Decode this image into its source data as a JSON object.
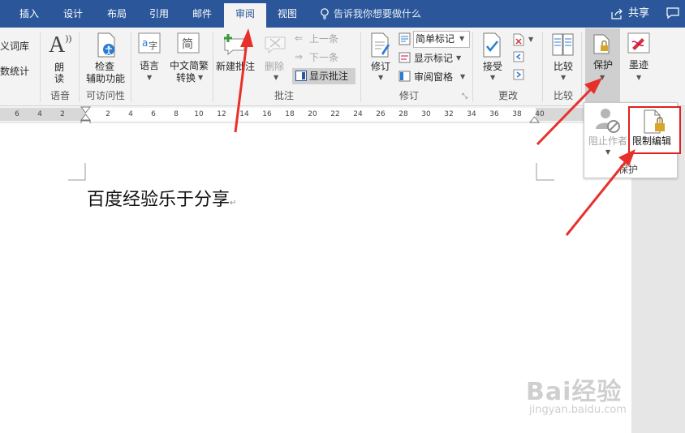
{
  "tabs": [
    "插入",
    "设计",
    "布局",
    "引用",
    "邮件",
    "审阅",
    "视图"
  ],
  "tell_me": "告诉我你想要做什么",
  "share": "共享",
  "ribbon": {
    "proofing_a": "义词库",
    "proofing_b": "数统计",
    "read_aloud": [
      "朗",
      "读"
    ],
    "check_accessibility": [
      "检查",
      "辅助功能"
    ],
    "language": "语言",
    "chinese_convert": [
      "中文简繁",
      "转换"
    ],
    "new_comment": "新建批注",
    "delete": "删除",
    "previous": "上一条",
    "next": "下一条",
    "show_comments": "显示批注",
    "track_changes": "修订",
    "markup_select": "简单标记",
    "show_markup": "显示标记",
    "reviewing_pane": "审阅窗格",
    "accept": "接受",
    "compare": "比较",
    "protect": "保护",
    "ink": "墨迹",
    "groups": {
      "speech": "语音",
      "accessibility": "可访问性",
      "comments": "批注",
      "tracking": "修订",
      "changes": "更改",
      "compare": "比较"
    }
  },
  "ruler_ticks": [
    "6",
    "4",
    "2",
    "2",
    "4",
    "6",
    "8",
    "10",
    "12",
    "14",
    "16",
    "18",
    "20",
    "22",
    "24",
    "26",
    "28",
    "30",
    "32",
    "34",
    "36",
    "38",
    "40"
  ],
  "document_text": "百度经验乐于分享",
  "protect_panel": {
    "block_authors": "阻止作者",
    "restrict_editing": "限制编辑",
    "group": "保护"
  },
  "watermark": {
    "logo": "Bai经验",
    "url": "jingyan.baidu.com"
  },
  "colors": {
    "tab_bar": "#2b579a",
    "ribbon": "#f3f3f3",
    "annotation_red": "#e8302b",
    "highlight_border": "#e0201f"
  }
}
